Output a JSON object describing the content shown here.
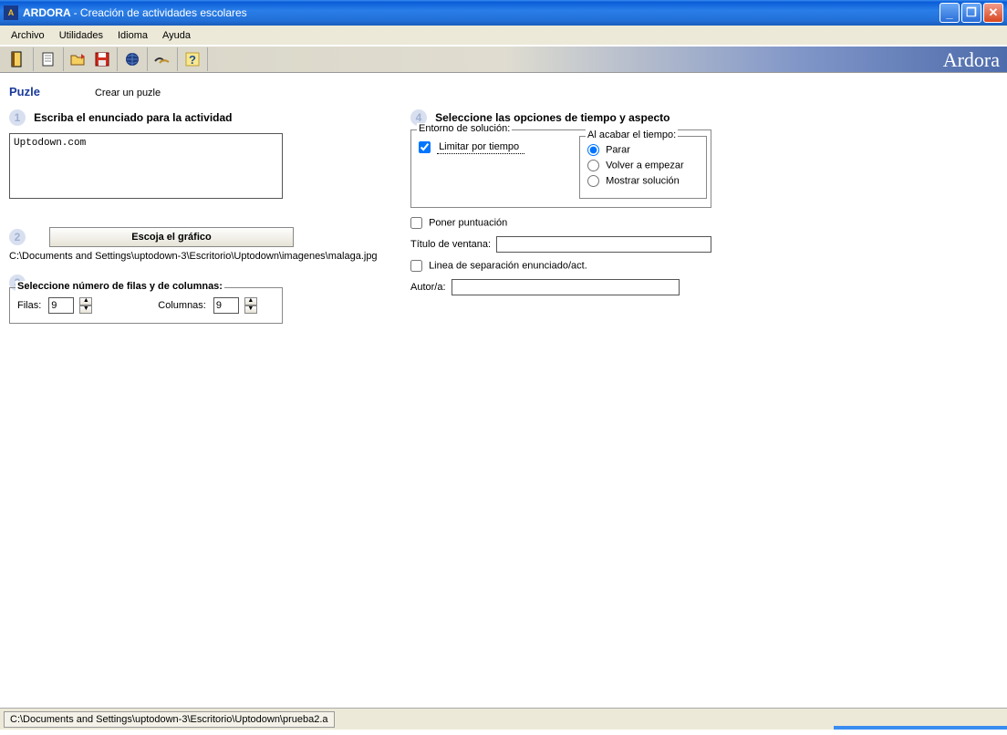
{
  "window": {
    "app_name": "ARDORA",
    "subtitle": "Creación de actividades escolares"
  },
  "menu": {
    "archivo": "Archivo",
    "utilidades": "Utilidades",
    "idioma": "Idioma",
    "ayuda": "Ayuda"
  },
  "brand": "Ardora",
  "header": {
    "activity": "Puzle",
    "description": "Crear un puzle"
  },
  "step1": {
    "title": "Escriba el enunciado para la actividad",
    "value": "Uptodown.com"
  },
  "step2": {
    "button": "Escoja el gráfico",
    "path": "C:\\Documents and Settings\\uptodown-3\\Escritorio\\Uptodown\\imagenes\\malaga.jpg"
  },
  "step3": {
    "legend": "Seleccione número de filas y de columnas:",
    "filas_label": "Filas:",
    "filas_value": "9",
    "columnas_label": "Columnas:",
    "columnas_value": "9"
  },
  "step4": {
    "title": "Seleccione las opciones de tiempo y aspecto",
    "solution_legend": "Entorno de solución:",
    "limit_time_label": "Limitar por tiempo",
    "time_end_legend": "Al acabar el tiempo:",
    "opt_parar": "Parar",
    "opt_volver": "Volver a empezar",
    "opt_mostrar": "Mostrar solución",
    "score_label": "Poner puntuación",
    "window_title_label": "Título de ventana:",
    "separator_label": "Linea de separación enunciado/act.",
    "author_label": "Autor/a:"
  },
  "footer": {
    "path": "C:\\Documents and Settings\\uptodown-3\\Escritorio\\Uptodown\\prueba2.a"
  },
  "numbers": {
    "n1": "1",
    "n2": "2",
    "n3": "3",
    "n4": "4"
  }
}
